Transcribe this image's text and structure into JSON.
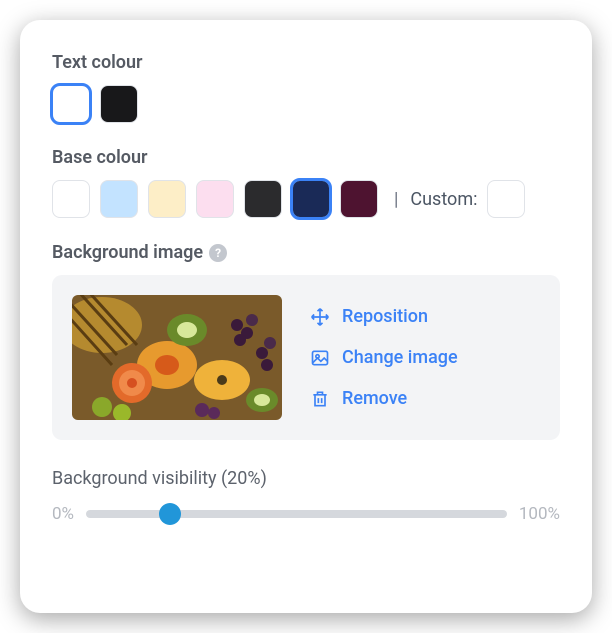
{
  "textColour": {
    "label": "Text colour",
    "swatches": [
      "#ffffff",
      "#18181a"
    ],
    "selectedIndex": 0
  },
  "baseColour": {
    "label": "Base colour",
    "swatches": [
      "#ffffff",
      "#c3e3ff",
      "#fdeec7",
      "#fcdeef",
      "#2b2b2d",
      "#1a2a57",
      "#4e1330"
    ],
    "selectedIndex": 5,
    "divider": "|",
    "customLabel": "Custom:",
    "customValue": "#ffffff"
  },
  "backgroundImage": {
    "label": "Background image",
    "actions": {
      "reposition": "Reposition",
      "change": "Change image",
      "remove": "Remove"
    }
  },
  "visibility": {
    "label": "Background visibility (20%)",
    "percent": 20,
    "minLabel": "0%",
    "maxLabel": "100%"
  }
}
